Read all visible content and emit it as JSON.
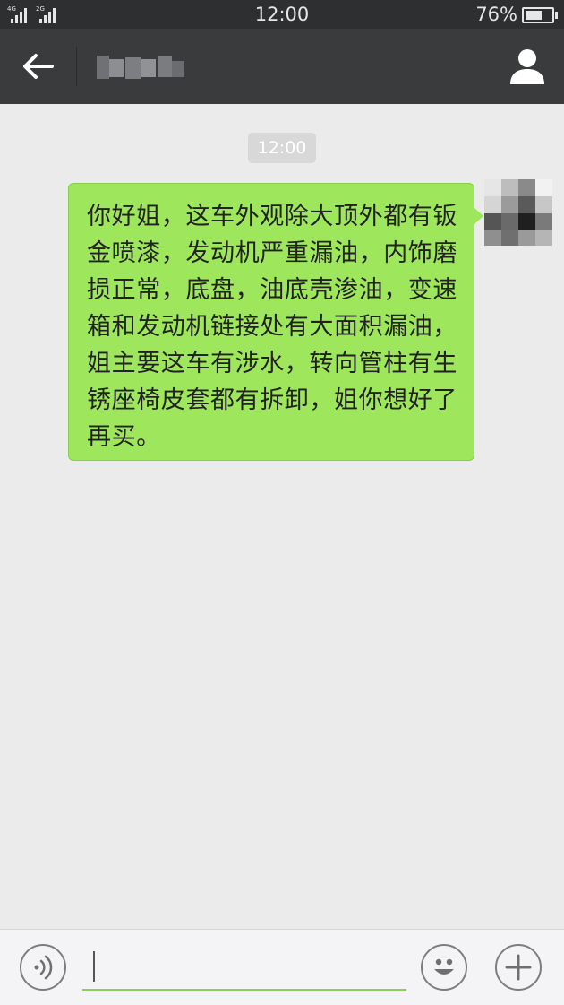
{
  "status_bar": {
    "signal_1_tag": "4G",
    "signal_2_tag": "2G",
    "time": "12:00",
    "battery_percent": "76%",
    "battery_level": 0.76,
    "icons": [
      "signal-4g-icon",
      "signal-2g-icon",
      "battery-icon"
    ]
  },
  "title_bar": {
    "back_icon": "arrow-left-icon",
    "contact_name_blurred": true,
    "profile_icon": "person-icon"
  },
  "chat": {
    "time_badge": "12:00",
    "messages": [
      {
        "direction": "outgoing",
        "text": "你好姐，这车外观除大顶外都有钣金喷漆，发动机严重漏油，内饰磨损正常，底盘，油底壳渗油，变速箱和发动机链接处有大面积漏油，姐主要这车有涉水，转向管柱有生锈座椅皮套都有拆卸，姐你想好了再买。",
        "avatar_blurred": true
      }
    ]
  },
  "input_bar": {
    "voice_icon": "voice-icon",
    "input_value": "",
    "emoji_icon": "emoji-icon",
    "plus_icon": "plus-icon"
  },
  "colors": {
    "status_bar_bg": "#2d2f31",
    "title_bar_bg": "#3a3b3d",
    "chat_bg": "#ebebeb",
    "bubble_bg": "#9ee75c",
    "input_underline": "#8bd05a"
  }
}
